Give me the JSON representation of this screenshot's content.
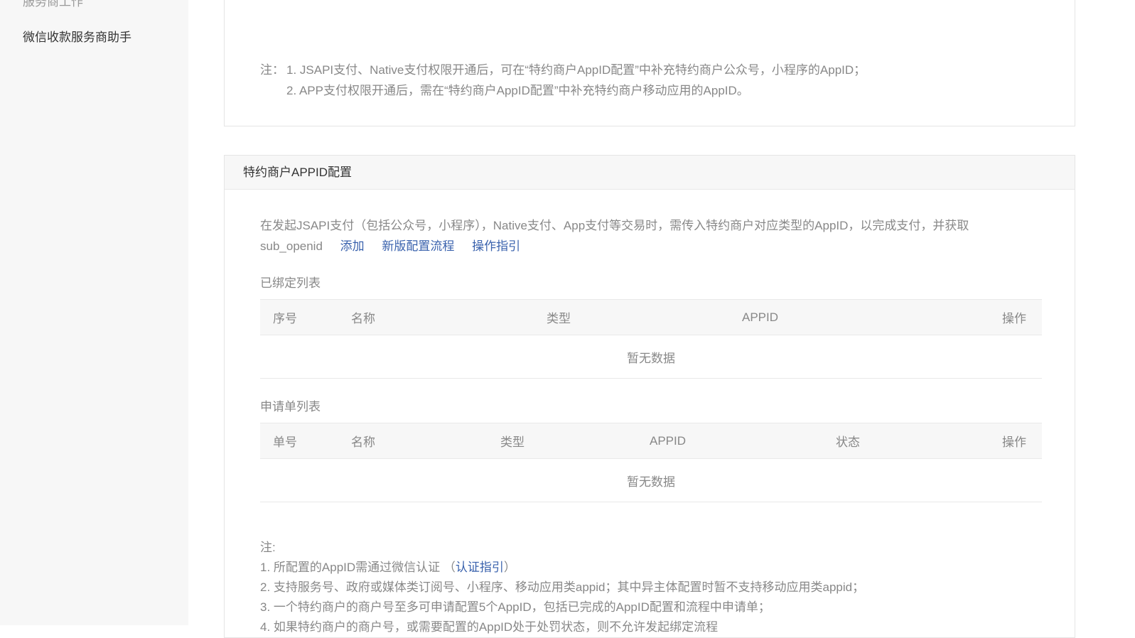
{
  "sidebar": {
    "items": [
      {
        "label": "服务商工作"
      },
      {
        "label": "微信收款服务商助手"
      }
    ]
  },
  "panel1": {
    "note_prefix": "注：",
    "notes": [
      "1. JSAPI支付、Native支付权限开通后，可在“特约商户AppID配置”中补充特约商户公众号，小程序的AppID；",
      "2. APP支付权限开通后，需在“特约商户AppID配置”中补充特约商户移动应用的AppID。"
    ]
  },
  "panel2": {
    "title": "特约商户APPID配置",
    "description": "在发起JSAPI支付（包括公众号，小程序），Native支付、App支付等交易时，需传入特约商户对应类型的AppID，以完成支付，并获取sub_openid",
    "links": {
      "add": "添加",
      "new_flow": "新版配置流程",
      "guide": "操作指引"
    },
    "bound_list": {
      "label": "已绑定列表",
      "columns": [
        "序号",
        "名称",
        "类型",
        "APPID",
        "操作"
      ],
      "empty_text": "暂无数据"
    },
    "application_list": {
      "label": "申请单列表",
      "columns": [
        "单号",
        "名称",
        "类型",
        "APPID",
        "状态",
        "操作"
      ],
      "empty_text": "暂无数据"
    },
    "notes": {
      "title": "注:",
      "item1_text": "1. 所配置的AppID需通过微信认证 （",
      "item1_link": "认证指引",
      "item1_suffix": "）",
      "item2": "2. 支持服务号、政府或媒体类订阅号、小程序、移动应用类appid；其中异主体配置时暂不支持移动应用类appid；",
      "item3": "3. 一个特约商户的商户号至多可申请配置5个AppID，包括已完成的AppID配置和流程中申请单；",
      "item4": "4. 如果特约商户的商户号，或需要配置的AppID处于处罚状态，则不允许发起绑定流程"
    }
  }
}
